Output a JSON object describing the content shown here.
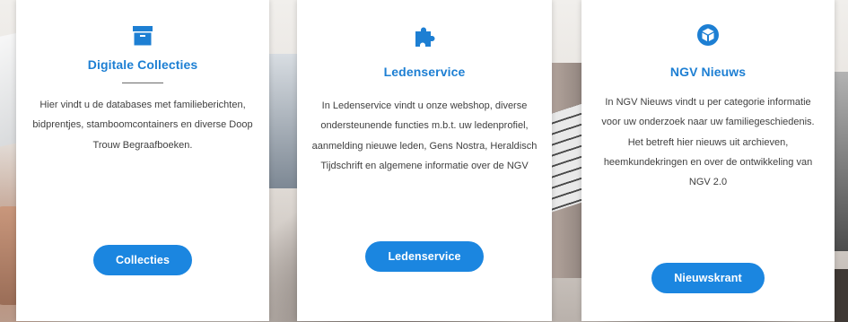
{
  "accent_color": "#1b86e0",
  "cards": [
    {
      "icon": "archive-box-icon",
      "title": "Digitale Collecties",
      "description": "Hier vindt u de databases met familieberichten, bidprentjes, stamboomcontainers en diverse Doop Trouw Begraafboeken.",
      "button_label": "Collecties"
    },
    {
      "icon": "puzzle-piece-icon",
      "title": "Ledenservice",
      "description": "In Ledenservice vindt u onze webshop, diverse ondersteunende functies m.b.t. uw ledenprofiel, aanmelding nieuwe leden, Gens Nostra, Heraldisch Tijdschrift en algemene informatie over de NGV",
      "button_label": "Ledenservice"
    },
    {
      "icon": "cube-icon",
      "title": "NGV Nieuws",
      "description": "In NGV Nieuws vindt u per categorie informatie voor uw onderzoek naar uw familiegeschiedenis. Het betreft hier nieuws uit archieven, heemkundekringen en over de ontwikkeling van NGV 2.0",
      "button_label": "Nieuwskrant"
    }
  ]
}
